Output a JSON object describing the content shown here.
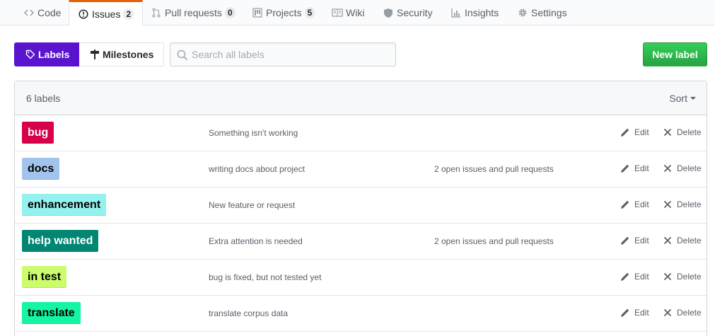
{
  "repo_nav": {
    "tabs": [
      {
        "label": "Code",
        "icon": "code-icon"
      },
      {
        "label": "Issues",
        "icon": "issue-opened-icon",
        "count": "2"
      },
      {
        "label": "Pull requests",
        "icon": "git-pull-request-icon",
        "count": "0"
      },
      {
        "label": "Projects",
        "icon": "project-icon",
        "count": "5"
      },
      {
        "label": "Wiki",
        "icon": "book-icon"
      },
      {
        "label": "Security",
        "icon": "shield-icon"
      },
      {
        "label": "Insights",
        "icon": "graph-icon"
      },
      {
        "label": "Settings",
        "icon": "gear-icon"
      }
    ],
    "selected": "Issues"
  },
  "subnav": {
    "labels": "Labels",
    "milestones": "Milestones"
  },
  "search": {
    "placeholder": "Search all labels"
  },
  "new_label_button": "New label",
  "labels_box": {
    "count_text": "6 labels",
    "sort_label": "Sort"
  },
  "actions": {
    "edit": "Edit",
    "delete": "Delete"
  },
  "labels": [
    {
      "name": "bug",
      "description": "Something isn't working",
      "issues": "",
      "bg": "#d7004b",
      "fg": "#ffffff"
    },
    {
      "name": "docs",
      "description": "writing docs about project",
      "issues": "2 open issues and pull requests",
      "bg": "#a2c4ec",
      "fg": "#000000"
    },
    {
      "name": "enhancement",
      "description": "New feature or request",
      "issues": "",
      "bg": "#94f2ee",
      "fg": "#000000"
    },
    {
      "name": "help wanted",
      "description": "Extra attention is needed",
      "issues": "2 open issues and pull requests",
      "bg": "#008672",
      "fg": "#ffffff"
    },
    {
      "name": "in test",
      "description": "bug is fixed, but not tested yet",
      "issues": "",
      "bg": "#cbfc6c",
      "fg": "#000000"
    },
    {
      "name": "translate",
      "description": "translate corpus data",
      "issues": "",
      "bg": "#15f6a3",
      "fg": "#000000"
    }
  ]
}
